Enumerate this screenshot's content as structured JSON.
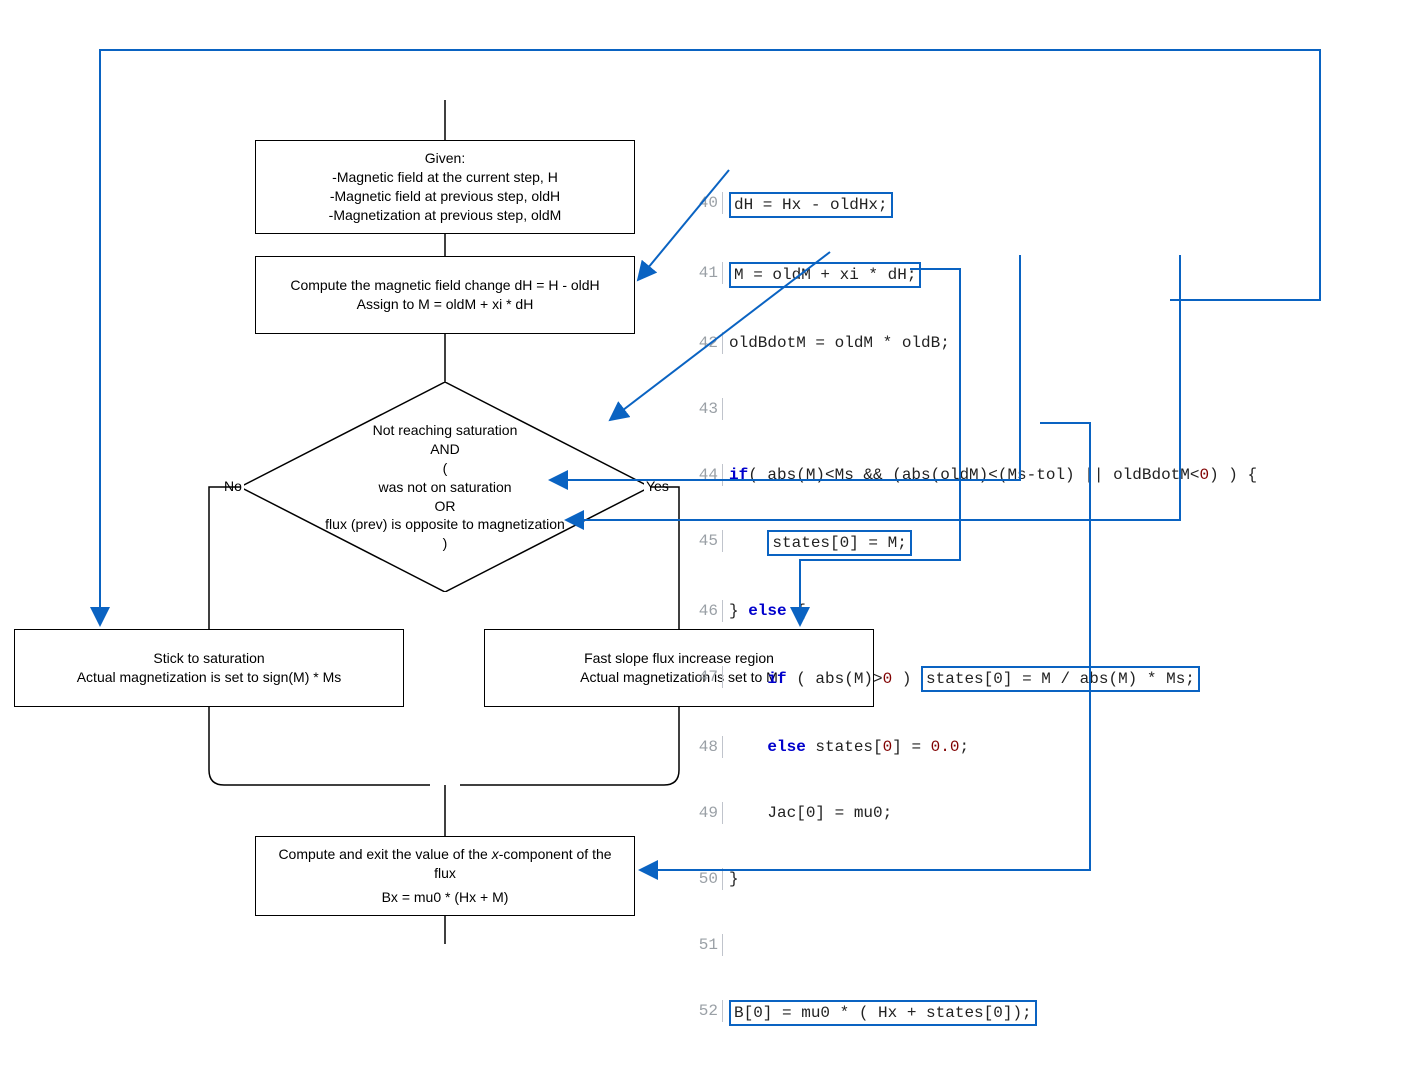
{
  "flow": {
    "given": {
      "title": "Given:",
      "l1": "-Magnetic field at the current step, H",
      "l2": "-Magnetic field at previous step, oldH",
      "l3": "-Magnetization at previous step, oldM"
    },
    "compute": {
      "l1": "Compute the magnetic field change dH = H - oldH",
      "l2": "Assign to M = oldM + xi * dH"
    },
    "decision": {
      "l1": "Not reaching saturation",
      "l2": "AND",
      "l3": "(",
      "l4": "was not on saturation",
      "l5": "OR",
      "l6": "flux (prev) is opposite to magnetization",
      "l7": ")"
    },
    "labels": {
      "no": "No",
      "yes": "Yes"
    },
    "noBranch": {
      "l1": "Stick to saturation",
      "l2": "Actual magnetization is set to sign(M) * Ms"
    },
    "yesBranch": {
      "l1": "Fast slope flux increase region",
      "l2": "Actual magnetization is set to M"
    },
    "exit": {
      "l1_a": "Compute and exit the value of the ",
      "l1_b": "x",
      "l1_c": "-component of the flux",
      "l2": "Bx  = mu0 * (Hx + M)"
    }
  },
  "code": {
    "lines": [
      {
        "n": "40",
        "pre": "",
        "boxed": "dH = Hx - oldHx;",
        "post": ""
      },
      {
        "n": "41",
        "pre": "",
        "boxed": "M = oldM + xi * dH;",
        "post": ""
      },
      {
        "n": "42",
        "plain": "oldBdotM = oldM * oldB;"
      },
      {
        "n": "43",
        "plain": ""
      },
      {
        "n": "44",
        "if": "if( abs(M)<Ms && (abs(oldM)<(Ms-tol) || oldBdotM<0) ) {"
      },
      {
        "n": "45",
        "pre": "    ",
        "boxed": "states[0] = M;",
        "post": ""
      },
      {
        "n": "46",
        "else": "} else {"
      },
      {
        "n": "47",
        "if2_pre": "    if ( abs(M)>0 ) ",
        "if2_box": "states[0] = M / abs(M) * Ms;"
      },
      {
        "n": "48",
        "else2": "    else states[0] = 0.0;"
      },
      {
        "n": "49",
        "plain": "    Jac[0] = mu0;"
      },
      {
        "n": "50",
        "plain": "}"
      },
      {
        "n": "51",
        "plain": ""
      },
      {
        "n": "52",
        "pre": "",
        "boxed": "B[0] = mu0 * ( Hx + states[0]);",
        "post": ""
      }
    ]
  }
}
